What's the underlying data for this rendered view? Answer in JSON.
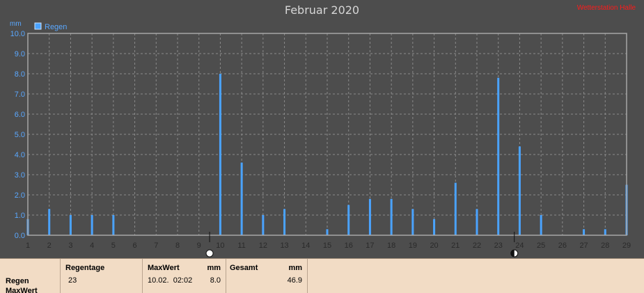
{
  "title": "Februar 2020",
  "brand": "Wetterstation Halle",
  "chart_data": {
    "type": "bar",
    "title": "Februar 2020",
    "ylabel": "mm",
    "ylim": [
      0,
      10
    ],
    "yticks": [
      "0.0",
      "1.0",
      "2.0",
      "3.0",
      "4.0",
      "5.0",
      "6.0",
      "7.0",
      "8.0",
      "9.0",
      "10.0"
    ],
    "categories": [
      "1",
      "2",
      "3",
      "4",
      "5",
      "6",
      "7",
      "8",
      "9",
      "10",
      "11",
      "12",
      "13",
      "14",
      "15",
      "16",
      "17",
      "18",
      "19",
      "20",
      "21",
      "22",
      "23",
      "24",
      "25",
      "26",
      "27",
      "28",
      "29"
    ],
    "series": [
      {
        "name": "Regen",
        "color": "#4aa3ff",
        "values": [
          0.8,
          1.3,
          1.0,
          1.0,
          1.0,
          0,
          0,
          0,
          0,
          8.0,
          3.6,
          1.0,
          1.3,
          0,
          0.3,
          1.5,
          1.8,
          1.8,
          1.3,
          0.8,
          2.6,
          1.3,
          7.8,
          4.4,
          1.0,
          0,
          0.3,
          0.3,
          2.5
        ]
      }
    ],
    "grid": true,
    "legend": "top-left",
    "moon_phases": [
      {
        "day": 9.5,
        "phase": "full-moon-icon"
      },
      {
        "day": 23.75,
        "phase": "new-moon-icon"
      }
    ]
  },
  "summary": {
    "row_label": "Regen",
    "row_label2": "MaxWert",
    "regentage_label": "Regentage",
    "regentage_value": "23",
    "maxwert_label": "MaxWert",
    "maxwert_unit": "mm",
    "maxwert_date": "10.02.  02:02",
    "maxwert_value": "8.0",
    "gesamt_label": "Gesamt",
    "gesamt_unit": "mm",
    "gesamt_value": "46.9"
  }
}
